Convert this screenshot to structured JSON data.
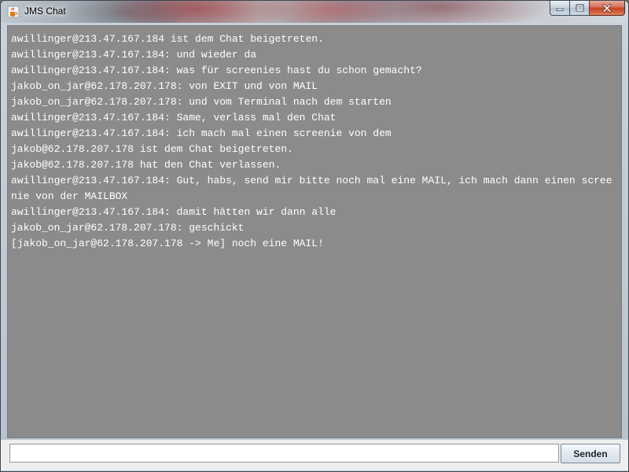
{
  "window": {
    "title": "JMS Chat",
    "app_icon": "java-cup-icon",
    "controls": {
      "minimize_icon": "minimize-icon",
      "maximize_icon": "maximize-icon",
      "close_icon": "close-icon",
      "close_color": "#c8442a"
    }
  },
  "chat": {
    "background_color": "#8b8b8b",
    "text_color": "#ffffff",
    "messages": [
      "awillinger@213.47.167.184 ist dem Chat beigetreten.",
      "awillinger@213.47.167.184: und wieder da",
      "awillinger@213.47.167.184: was für screenies hast du schon gemacht?",
      "jakob_on_jar@62.178.207.178: von EXIT und von MAIL",
      "jakob_on_jar@62.178.207.178: und vom Terminal nach dem starten",
      "awillinger@213.47.167.184: Same, verlass mal den Chat",
      "awillinger@213.47.167.184: ich mach mal einen screenie von dem",
      "jakob@62.178.207.178 ist dem Chat beigetreten.",
      "jakob@62.178.207.178 hat den Chat verlassen.",
      "awillinger@213.47.167.184: Gut, habs, send mir bitte noch mal eine MAIL, ich mach dann einen screenie von der MAILBOX",
      "awillinger@213.47.167.184: damit hätten wir dann alle",
      "jakob_on_jar@62.178.207.178: geschickt",
      "[jakob_on_jar@62.178.207.178 -> Me] noch eine MAIL!"
    ]
  },
  "input": {
    "value": "",
    "placeholder": ""
  },
  "send_button": {
    "label": "Senden"
  }
}
